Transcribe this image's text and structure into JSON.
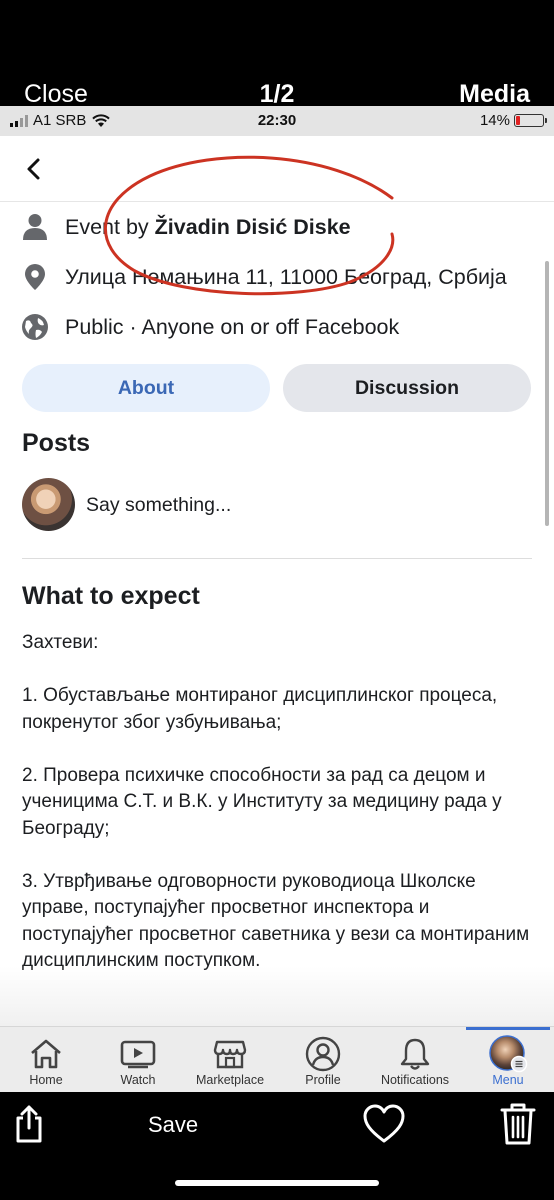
{
  "viewer": {
    "close_label": "Close",
    "counter": "1/2",
    "media_label": "Media",
    "save_label": "Save"
  },
  "status_bar": {
    "carrier": "A1 SRB",
    "time": "22:30",
    "battery": "14%",
    "battery_level": 0.14
  },
  "event": {
    "host_prefix": "Event by ",
    "host_name": "Živadin Disić Diske",
    "location": "Улица Немањина 11, 11000 Београд, Србија",
    "privacy": "Public · Anyone on or off Facebook"
  },
  "tabs": {
    "about": "About",
    "discussion": "Discussion"
  },
  "posts": {
    "title": "Posts",
    "placeholder": "Say something..."
  },
  "expect": {
    "title": "What to expect",
    "paragraphs": [
      "Захтеви:",
      "1. Обустављање монтираног дисциплинског процеса, покренутог због узбуњивања;",
      "2. Провера психичке способности за рад са децом и ученицима С.Т. и В.К. у Институту за медицину рада у Београду;",
      "3. Утврђивање одговорности руководиоца Школске управе, поступајућег просветног инспектора и поступајућег просветног саветника у вези са монтираним дисциплинским поступком."
    ]
  },
  "bottom_nav": {
    "items": [
      {
        "label": "Home",
        "icon": "home-icon"
      },
      {
        "label": "Watch",
        "icon": "watch-icon"
      },
      {
        "label": "Marketplace",
        "icon": "marketplace-icon"
      },
      {
        "label": "Profile",
        "icon": "profile-icon"
      },
      {
        "label": "Notifications",
        "icon": "bell-icon"
      },
      {
        "label": "Menu",
        "icon": "menu-avatar-icon"
      }
    ],
    "active": "Menu"
  },
  "colors": {
    "accent": "#3b6fd0",
    "about_tab_bg": "#e7f0fc",
    "annotation": "#cc3322"
  }
}
